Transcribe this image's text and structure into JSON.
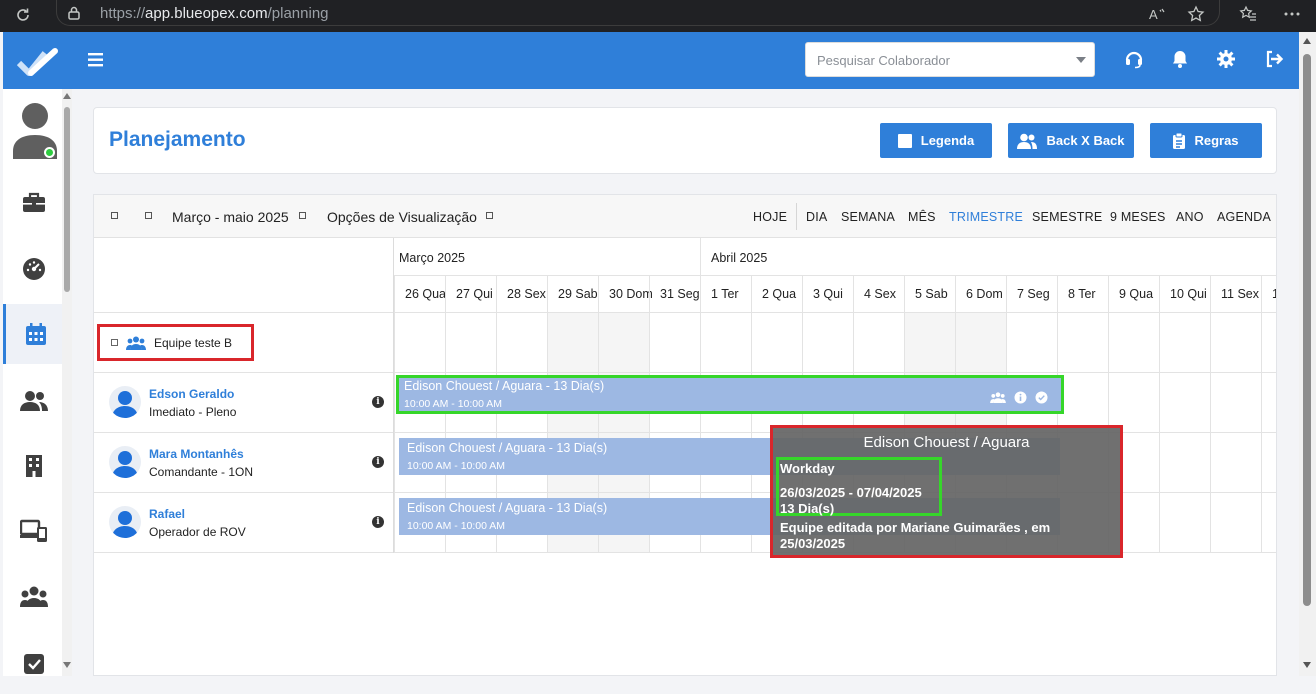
{
  "browser": {
    "url_prefix": "https://",
    "url_host": "app.blueopex.com",
    "url_path": "/planning"
  },
  "header": {
    "search_placeholder": "Pesquisar Colaborador",
    "icons": [
      "headset-icon",
      "bell-icon",
      "gear-icon",
      "logout-icon"
    ]
  },
  "sidebar": {
    "items": [
      "briefcase-icon",
      "dashboard-icon",
      "calendar-icon",
      "users-icon",
      "building-icon",
      "devices-icon",
      "team-icon",
      "checkbox-icon"
    ],
    "active": "calendar-icon"
  },
  "page": {
    "title": "Planejamento",
    "buttons": {
      "legend": "Legenda",
      "backxback": "Back X Back",
      "rules": "Regras"
    }
  },
  "calendar": {
    "range_label": "Março - maio 2025",
    "view_options": "Opções de Visualização",
    "views": [
      "HOJE",
      "DIA",
      "SEMANA",
      "MÊS",
      "TRIMESTRE",
      "SEMESTRE",
      "9 MESES",
      "ANO",
      "AGENDA"
    ],
    "active_view": "TRIMESTRE",
    "months": [
      "Março 2025",
      "Abril 2025"
    ],
    "days": [
      {
        "n": "26",
        "d": "Qua"
      },
      {
        "n": "27",
        "d": "Qui"
      },
      {
        "n": "28",
        "d": "Sex"
      },
      {
        "n": "29",
        "d": "Sab"
      },
      {
        "n": "30",
        "d": "Dom"
      },
      {
        "n": "31",
        "d": "Seg"
      },
      {
        "n": "1",
        "d": "Ter"
      },
      {
        "n": "2",
        "d": "Qua"
      },
      {
        "n": "3",
        "d": "Qui"
      },
      {
        "n": "4",
        "d": "Sex"
      },
      {
        "n": "5",
        "d": "Sab"
      },
      {
        "n": "6",
        "d": "Dom"
      },
      {
        "n": "7",
        "d": "Seg"
      },
      {
        "n": "8",
        "d": "Ter"
      },
      {
        "n": "9",
        "d": "Qua"
      },
      {
        "n": "10",
        "d": "Qui"
      },
      {
        "n": "11",
        "d": "Sex"
      },
      {
        "n": "1",
        "d": ""
      }
    ],
    "team": "Equipe teste B",
    "people": [
      {
        "name": "Edson Geraldo",
        "role": "Imediato - Pleno"
      },
      {
        "name": "Mara Montanhês",
        "role": "Comandante - 1ON"
      },
      {
        "name": "Rafael",
        "role": "Operador de ROV"
      }
    ],
    "event": {
      "title": "Edison Chouest / Aguara - 13 Dia(s)",
      "time": "10:00 AM - 10:00 AM"
    }
  },
  "tooltip": {
    "title": "Edison Chouest / Aguara",
    "label": "Workday",
    "dates": "26/03/2025 - 07/04/2025",
    "days": "13 Dia(s)",
    "edited": "Equipe editada por Mariane Guimarães , em 25/03/2025"
  }
}
